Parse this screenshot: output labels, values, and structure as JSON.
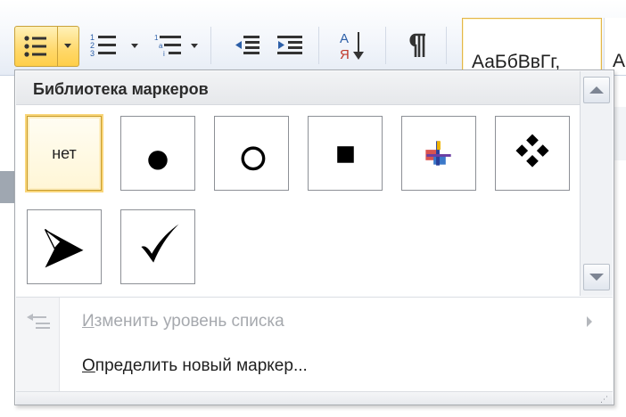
{
  "ribbon": {
    "styles_preview": "АаБбВвГг,",
    "styles_preview_next": "А"
  },
  "panel": {
    "title": "Библиотека маркеров",
    "bullets": [
      {
        "label": "нет",
        "icon": "none-bullet",
        "selected": true
      },
      {
        "label": "",
        "icon": "filled-circle-bullet",
        "selected": false
      },
      {
        "label": "",
        "icon": "hollow-circle-bullet",
        "selected": false
      },
      {
        "label": "",
        "icon": "filled-square-bullet",
        "selected": false
      },
      {
        "label": "",
        "icon": "colored-cross-bullet",
        "selected": false
      },
      {
        "label": "",
        "icon": "four-diamond-bullet",
        "selected": false
      },
      {
        "label": "",
        "icon": "arrowhead-bullet",
        "selected": false
      },
      {
        "label": "",
        "icon": "checkmark-bullet",
        "selected": false
      }
    ],
    "menu": [
      {
        "label": "Изменить уровень списка",
        "enabled": false,
        "underline_char": "И"
      },
      {
        "label": "Определить новый маркер...",
        "enabled": true,
        "underline_char": "О"
      }
    ]
  },
  "colors": {
    "selected_highlight": "#ffd86a",
    "disabled_text": "#a6a9ae"
  }
}
